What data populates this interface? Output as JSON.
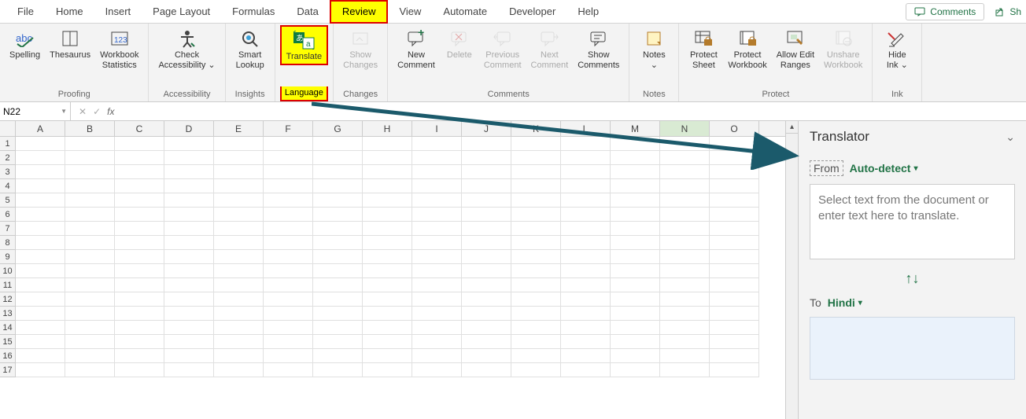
{
  "tabs": {
    "items": [
      "File",
      "Home",
      "Insert",
      "Page Layout",
      "Formulas",
      "Data",
      "Review",
      "View",
      "Automate",
      "Developer",
      "Help"
    ],
    "highlighted": "Review",
    "comments_label": "Comments",
    "share_label": "Sh"
  },
  "ribbon": {
    "groups": [
      {
        "label": "Proofing",
        "buttons": [
          {
            "label": "Spelling",
            "icon": "spelling-icon"
          },
          {
            "label": "Thesaurus",
            "icon": "thesaurus-icon"
          },
          {
            "label": "Workbook\nStatistics",
            "icon": "stats-icon"
          }
        ]
      },
      {
        "label": "Accessibility",
        "buttons": [
          {
            "label": "Check\nAccessibility ⌄",
            "icon": "accessibility-icon"
          }
        ]
      },
      {
        "label": "Insights",
        "buttons": [
          {
            "label": "Smart\nLookup",
            "icon": "lookup-icon"
          }
        ]
      },
      {
        "label": "Language",
        "highlighted": true,
        "buttons": [
          {
            "label": "Translate",
            "icon": "translate-icon",
            "highlighted": true
          }
        ]
      },
      {
        "label": "Changes",
        "buttons": [
          {
            "label": "Show\nChanges",
            "icon": "changes-icon",
            "disabled": true
          }
        ]
      },
      {
        "label": "Comments",
        "buttons": [
          {
            "label": "New\nComment",
            "icon": "new-comment-icon"
          },
          {
            "label": "Delete",
            "icon": "delete-icon",
            "disabled": true
          },
          {
            "label": "Previous\nComment",
            "icon": "prev-comment-icon",
            "disabled": true
          },
          {
            "label": "Next\nComment",
            "icon": "next-comment-icon",
            "disabled": true
          },
          {
            "label": "Show\nComments",
            "icon": "show-comments-icon"
          }
        ]
      },
      {
        "label": "Notes",
        "buttons": [
          {
            "label": "Notes\n⌄",
            "icon": "notes-icon"
          }
        ]
      },
      {
        "label": "Protect",
        "buttons": [
          {
            "label": "Protect\nSheet",
            "icon": "protect-sheet-icon"
          },
          {
            "label": "Protect\nWorkbook",
            "icon": "protect-workbook-icon"
          },
          {
            "label": "Allow Edit\nRanges",
            "icon": "allow-edit-icon"
          },
          {
            "label": "Unshare\nWorkbook",
            "icon": "unshare-icon",
            "disabled": true
          }
        ]
      },
      {
        "label": "Ink",
        "buttons": [
          {
            "label": "Hide\nInk ⌄",
            "icon": "ink-icon"
          }
        ]
      }
    ]
  },
  "formula_bar": {
    "name_box": "N22",
    "fx": "fx"
  },
  "grid": {
    "columns": [
      "A",
      "B",
      "C",
      "D",
      "E",
      "F",
      "G",
      "H",
      "I",
      "J",
      "K",
      "L",
      "M",
      "N",
      "O"
    ],
    "selected_col": "N",
    "rows": [
      1,
      2,
      3,
      4,
      5,
      6,
      7,
      8,
      9,
      10,
      11,
      12,
      13,
      14,
      15,
      16,
      17
    ]
  },
  "translator": {
    "title": "Translator",
    "from_label": "From",
    "from_lang": "Auto-detect",
    "placeholder": "Select text from the document or enter text here to translate.",
    "swap_icon": "↑↓",
    "to_label": "To",
    "to_lang": "Hindi"
  },
  "colors": {
    "accent": "#217346",
    "highlight_bg": "#ffff00",
    "highlight_border": "#d00000",
    "arrow": "#1b5a6b"
  }
}
